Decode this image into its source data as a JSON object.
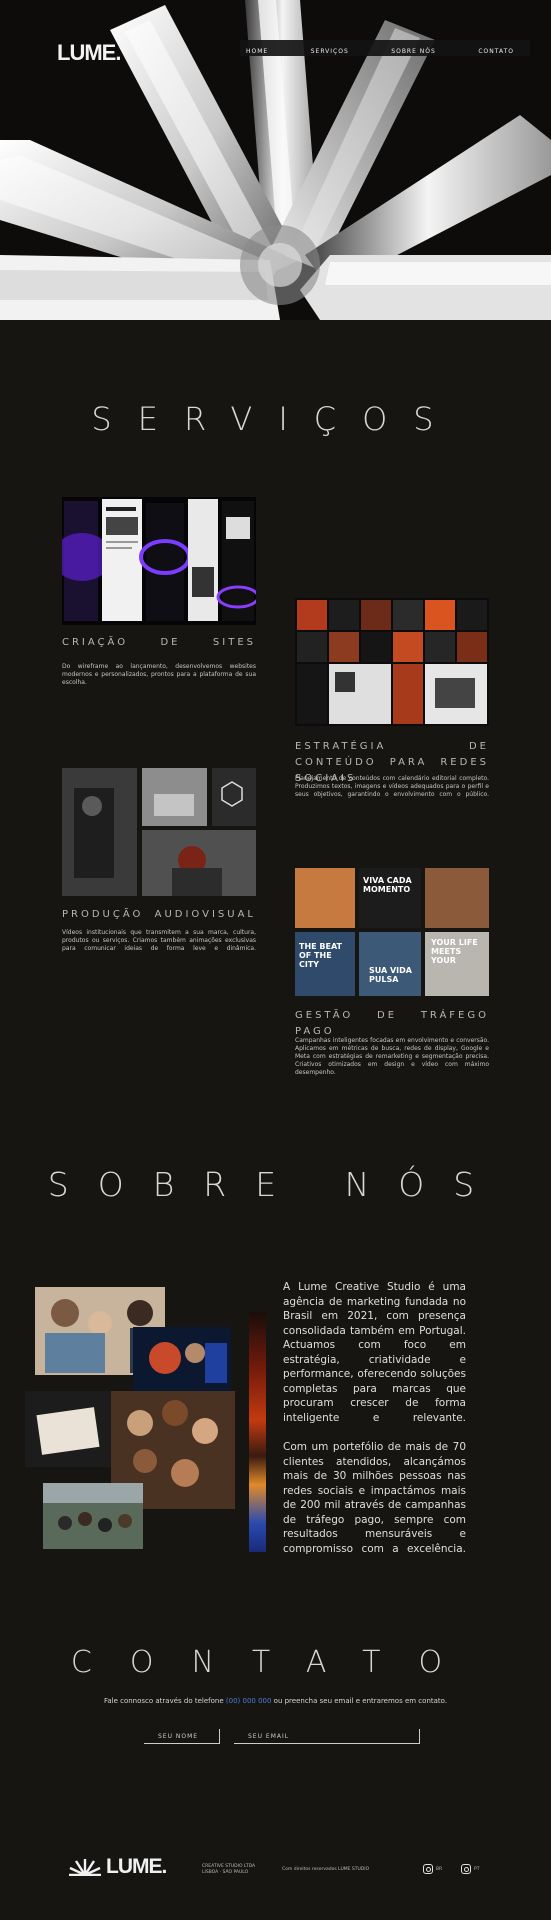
{
  "brand": {
    "name": "LUME."
  },
  "nav": {
    "items": [
      "HOME",
      "SERVIÇOS",
      "SOBRE NÓS",
      "CONTATO"
    ]
  },
  "services": {
    "title": "SERVIÇOS",
    "items": [
      {
        "title": "CRIAÇÃO DE SITES",
        "description": "Do wireframe ao lançamento, desenvolvemos websites modernos e personalizados, prontos para a plataforma de sua escolha."
      },
      {
        "title": "ESTRATÉGIA DE CONTEÚDO PARA REDES SOCIAIS",
        "description": "Planejamento de conteúdos com calendário editorial completo. Produzimos textos, imagens e vídeos adequados para o perfil e seus objetivos, garantindo o envolvimento com o público."
      },
      {
        "title": "PRODUÇÃO AUDIOVISUAL",
        "description": "Vídeos institucionais que transmitem a sua marca, cultura, produtos ou serviços. Criamos também animações exclusivas para comunicar ideias de forma leve e dinâmica."
      },
      {
        "title": "GESTÃO DE TRÁFEGO PAGO",
        "description": "Campanhas inteligentes focadas em envolvimento e conversão. Aplicamos em métricas de busca, redes de display, Google e Meta com estratégias de remarketing e segmentação precisa. Criativos otimizados em design e vídeo com máximo desempenho."
      }
    ],
    "tile_texts": [
      "VIVA CADA MOMENTO",
      "THE BEAT OF THE CITY",
      "YOUR LIFE MEETS YOUR",
      "SUA VIDA PULSA"
    ]
  },
  "about": {
    "title": "SOBRE NÓS",
    "paragraph1": "A Lume Creative Studio é uma agência de marketing fundada no Brasil em 2021, com presença consolidada também em Portugal. Actuamos com foco em estratégia, criatividade e performance, oferecendo soluções completas para marcas que procuram crescer de forma inteligente e relevante.",
    "paragraph2": "Com um portefólio de mais de 70 clientes atendidos, alcançámos mais de 30 milhões pessoas nas redes sociais e impactámos mais de 200 mil através de campanhas de tráfego pago, sempre com resultados mensuráveis e compromisso com a excelência."
  },
  "contact": {
    "title": "CONTATO",
    "line_before": "Fale connosco através do telefone ",
    "phone": "(00) 000 000",
    "line_after": " ou preencha seu email e entraremos em contato.",
    "name_placeholder": "SEU NOME",
    "email_placeholder": "SEU EMAIL"
  },
  "footer": {
    "brand": "LUME.",
    "address": [
      "CREATIVE STUDIO LTDA",
      "LISBOA · SÃO PAULO"
    ],
    "copyright": "Com direitos reservados LUME STUDIO",
    "socials": [
      {
        "icon": "instagram-icon",
        "label": "BR"
      },
      {
        "icon": "instagram-icon",
        "label": "PT"
      }
    ]
  },
  "colors": {
    "background": "#161512",
    "accent_link": "#4f7dd8",
    "text": "#e8e6e1"
  }
}
